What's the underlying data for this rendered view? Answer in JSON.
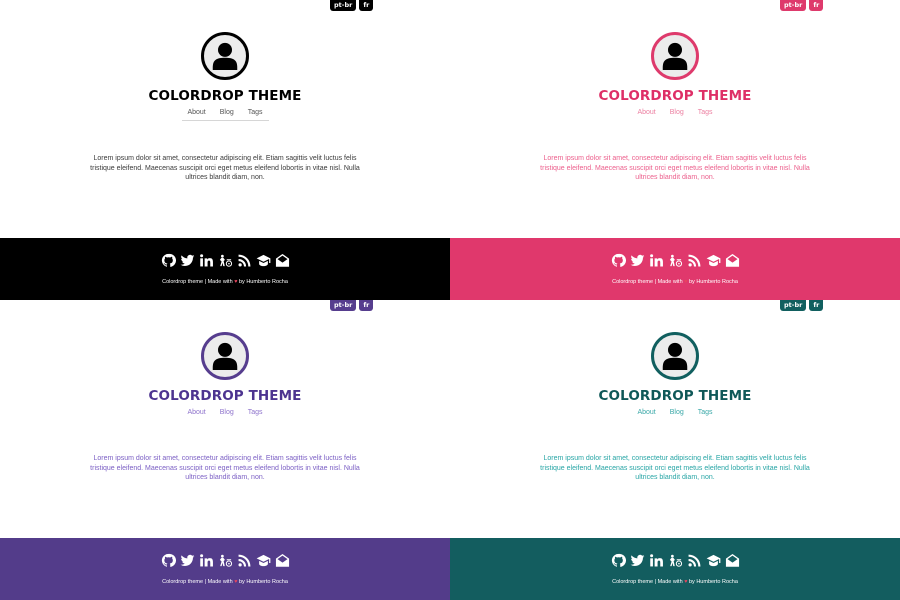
{
  "variants": [
    {
      "name": "black",
      "accent": "#000000",
      "text_color": "#3a3a3a",
      "nav_color": "#555555",
      "title_color": "#000000",
      "footer_bg": "#000000",
      "show_nav_rule": true
    },
    {
      "name": "pink",
      "accent": "#de3a6c",
      "text_color": "#ec5f8c",
      "nav_color": "#ec7fa1",
      "title_color": "#de2f67",
      "footer_bg": "#e0386c",
      "show_nav_rule": false
    },
    {
      "name": "purple",
      "accent": "#563d8e",
      "text_color": "#7b5fc4",
      "nav_color": "#8e73cc",
      "title_color": "#4d3490",
      "footer_bg": "#533c8a",
      "show_nav_rule": false
    },
    {
      "name": "teal",
      "accent": "#115f5f",
      "text_color": "#27a5a5",
      "nav_color": "#3aa8a8",
      "title_color": "#0f5858",
      "footer_bg": "#135d5f",
      "show_nav_rule": false
    }
  ],
  "langs": [
    "pt-br",
    "fr"
  ],
  "site_title": "COLORDROP THEME",
  "nav": [
    "About",
    "Blog",
    "Tags"
  ],
  "lorem": "Lorem ipsum dolor sit amet, consectetur adipiscing elit. Etiam sagittis velit luctus felis tristique eleifend. Maecenas suscipit orci eget metus eleifend lobortis in vitae nisl. Nulla ultrices blandit diam, non.",
  "footer_icons": [
    "github-icon",
    "twitter-icon",
    "linkedin-icon",
    "mastodon-icon",
    "rss-icon",
    "graduation-cap-icon",
    "envelope-icon"
  ],
  "credits": {
    "name": "Colordrop",
    "theme_word": "theme",
    "separator": "|",
    "made_with": "Made with",
    "heart": "♥",
    "by": "by",
    "author": "Humberto Rocha"
  }
}
